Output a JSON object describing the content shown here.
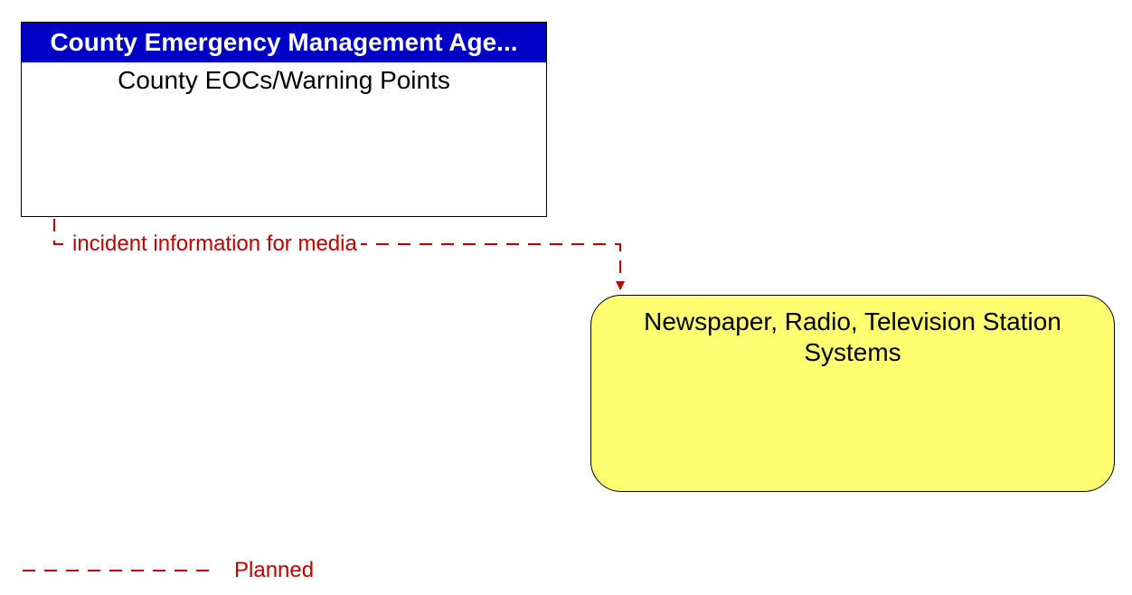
{
  "nodes": {
    "source": {
      "header": "County Emergency Management Age...",
      "title": "County EOCs/Warning Points"
    },
    "target": {
      "title": "Newspaper, Radio, Television Station Systems"
    }
  },
  "flow": {
    "label": "incident information for media"
  },
  "legend": {
    "planned": "Planned"
  },
  "colors": {
    "header_bg": "#0000c6",
    "target_bg": "#fefe70",
    "flow_line": "#c00000"
  }
}
